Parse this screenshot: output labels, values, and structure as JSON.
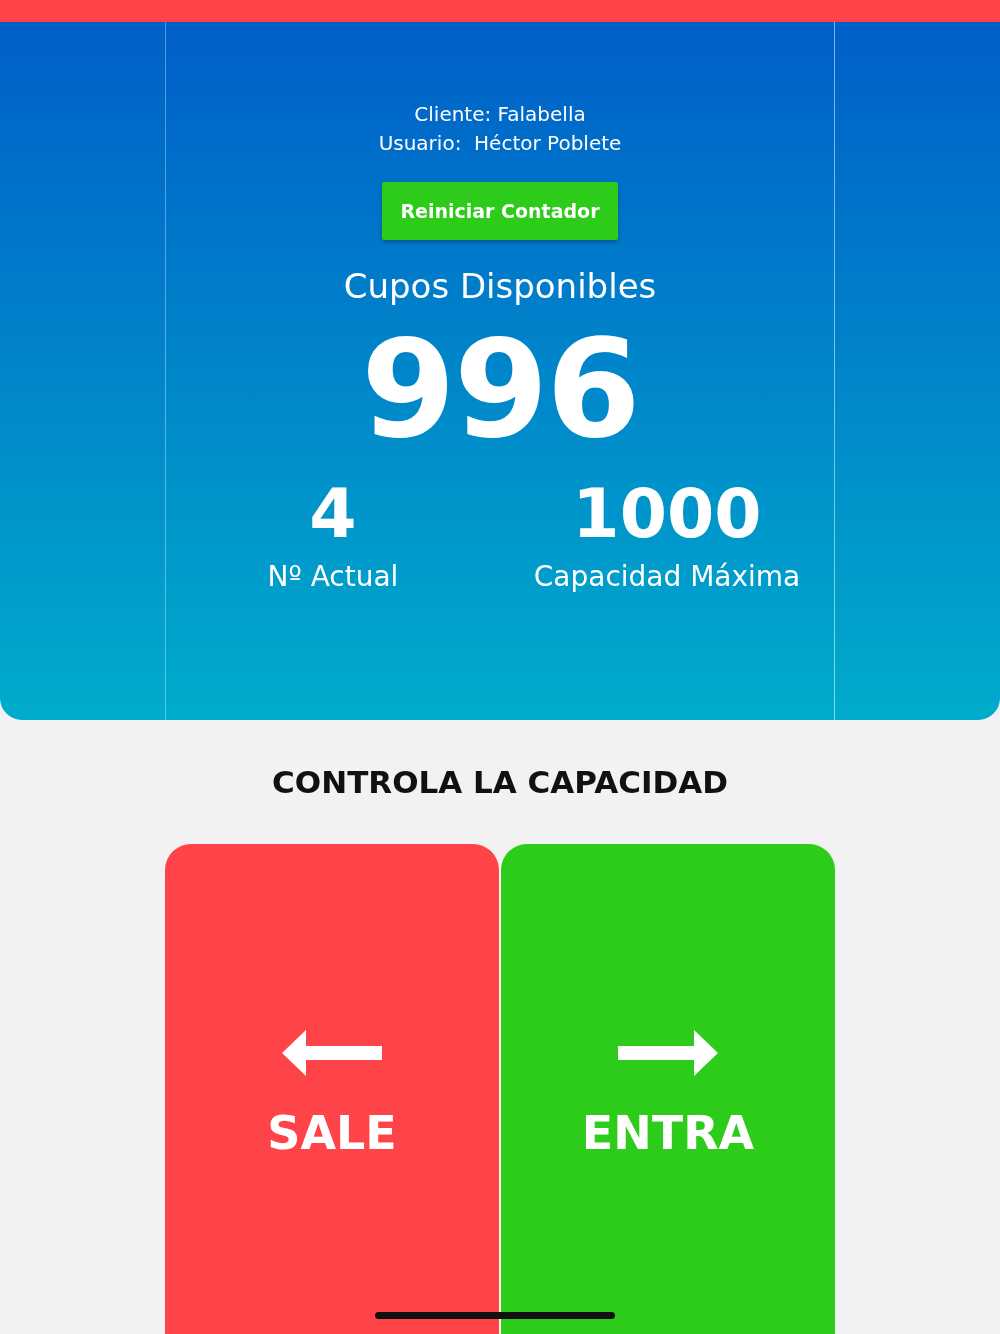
{
  "header": {
    "client": "Cliente: Falabella",
    "user": "Usuario:  Héctor Poblete"
  },
  "reset_button": {
    "label": "Reiniciar Contador"
  },
  "available": {
    "label": "Cupos Disponibles",
    "value": "996"
  },
  "stats": [
    {
      "value": "4",
      "label": "Nº Actual"
    },
    {
      "value": "1000",
      "label": "Capacidad Máxima"
    }
  ],
  "section_title": "CONTROLA LA CAPACIDAD",
  "actions": [
    {
      "kind": "exit",
      "label": "SALE"
    },
    {
      "kind": "enter",
      "label": "ENTRA"
    }
  ]
}
